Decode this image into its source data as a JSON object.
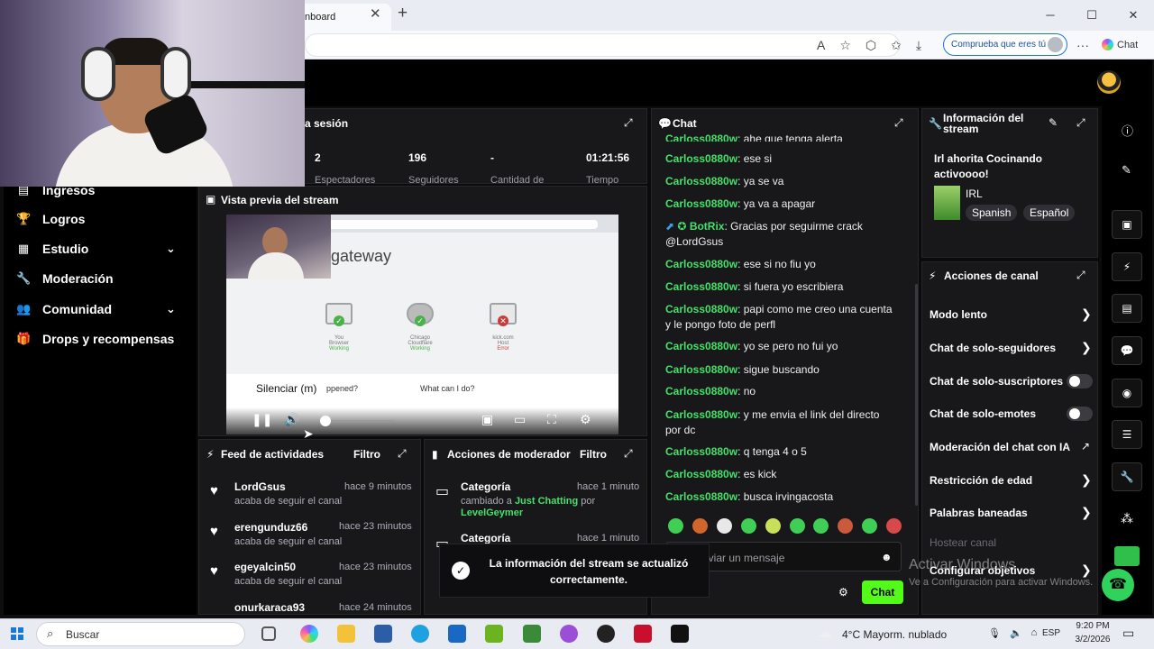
{
  "browser": {
    "tab_title": "nboard",
    "tab_close": "✕",
    "new_tab": "+",
    "copilot_button": "Comprueba que eres tú",
    "chat_label": "Chat",
    "more": "···",
    "window": {
      "minimize": "─",
      "maximize": "☐",
      "close": "✕"
    }
  },
  "sidebar": {
    "items": [
      {
        "label": "Ingresos",
        "icon": "ingresos-icon",
        "glyph": "▤"
      },
      {
        "label": "Logros",
        "icon": "trophy-icon",
        "glyph": "🏆"
      },
      {
        "label": "Estudio",
        "icon": "studio-icon",
        "glyph": "▦",
        "chevron": "⌄"
      },
      {
        "label": "Moderación",
        "icon": "wrench-icon",
        "glyph": "🔧"
      },
      {
        "label": "Comunidad",
        "icon": "community-icon",
        "glyph": "👥",
        "chevron": "⌄"
      },
      {
        "label": "Drops y recompensas",
        "icon": "gift-icon",
        "glyph": "🎁"
      }
    ]
  },
  "session": {
    "title": "a sesión",
    "stats": [
      {
        "value": "2",
        "label": "Espectadores"
      },
      {
        "value": "196",
        "label": "Seguidores"
      },
      {
        "value": "-",
        "label": "Cantidad de"
      },
      {
        "value": "01:21:56",
        "label": "Tiempo"
      }
    ]
  },
  "preview": {
    "title": "Vista previa del stream",
    "page_title": "gateway",
    "tooltip": "Silenciar (m)",
    "question1": "ppened?",
    "question2": "What can I do?",
    "nodes": [
      {
        "label": "You",
        "sub": "Browser",
        "status": "Working"
      },
      {
        "label": "Chicago",
        "sub": "Cloudflare",
        "status": "Working"
      },
      {
        "label": "kick.com",
        "sub": "Host",
        "status": "Error"
      }
    ]
  },
  "feed": {
    "title": "Feed de actividades",
    "filter": "Filtro",
    "items": [
      {
        "name": "LordGsus",
        "time": "hace 9 minutos",
        "desc": "acaba de seguir el canal"
      },
      {
        "name": "erengunduz66",
        "time": "hace 23 minutos",
        "desc": "acaba de seguir el canal"
      },
      {
        "name": "egeyalcin50",
        "time": "hace 23 minutos",
        "desc": "acaba de seguir el canal"
      },
      {
        "name": "onurkaraca93",
        "time": "hace 24 minutos",
        "desc": ""
      }
    ]
  },
  "modactions": {
    "title": "Acciones de moderador",
    "filter": "Filtro",
    "items": [
      {
        "title": "Categoría",
        "time": "hace 1 minuto",
        "line1": "cambiado a ",
        "highlight": "Just Chatting",
        "line1b": " por",
        "user": "LevelGeymer"
      },
      {
        "title": "Categoría",
        "time": "hace 1 minuto"
      }
    ]
  },
  "chat": {
    "title": "Chat",
    "messages": [
      {
        "user": "Carloss0880w",
        "text": "ahe que tenga alerta"
      },
      {
        "user": "Carloss0880w",
        "text": "ese si"
      },
      {
        "user": "Carloss0880w",
        "text": "ya se va"
      },
      {
        "user": "Carloss0880w",
        "text": "ya va a apagar"
      },
      {
        "user": "BotRix",
        "text": "Gracias por seguirme crack @LordGsus"
      },
      {
        "user": "Carloss0880w",
        "text": "ese si no fiu yo"
      },
      {
        "user": "Carloss0880w",
        "text": "si fuera yo escribiera"
      },
      {
        "user": "Carloss0880w",
        "text": "papi como me creo una cuenta y le pongo foto de perfl"
      },
      {
        "user": "Carloss0880w",
        "text": "yo se pero no fui yo"
      },
      {
        "user": "Carloss0880w",
        "text": "sigue buscando"
      },
      {
        "user": "Carloss0880w",
        "text": "no"
      },
      {
        "user": "Carloss0880w",
        "text": "y me envia el link del directo por dc"
      },
      {
        "user": "Carloss0880w",
        "text": "q tenga 4 o 5"
      },
      {
        "user": "Carloss0880w",
        "text": "es kick"
      },
      {
        "user": "Carloss0880w",
        "text": "busca irvingacosta"
      }
    ],
    "input_placeholder": "nviar un mensaje",
    "send": "Chat"
  },
  "streaminfo": {
    "title": "Información del stream",
    "stream_title": "Irl ahorita Cocinando activoooo!",
    "category": "IRL",
    "tags": [
      "Spanish",
      "Español"
    ]
  },
  "channel": {
    "title": "Acciones de canal",
    "items": [
      {
        "label": "Modo lento",
        "kind": "chevron"
      },
      {
        "label": "Chat de solo-seguidores",
        "kind": "chevron"
      },
      {
        "label": "Chat de solo-suscriptores",
        "kind": "toggle"
      },
      {
        "label": "Chat de solo-emotes",
        "kind": "toggle"
      },
      {
        "label": "Moderación del chat con IA",
        "kind": "external"
      },
      {
        "label": "Restricción de edad",
        "kind": "chevron"
      },
      {
        "label": "Palabras baneadas",
        "kind": "chevron"
      },
      {
        "label": "Hostear canal",
        "kind": "disabled"
      },
      {
        "label": "Configurar objetivos",
        "kind": "chevron"
      }
    ]
  },
  "toast": {
    "text": "La información del stream se actualizó correctamente."
  },
  "watermark": {
    "line1": "Activar Windows",
    "line2": "Ve a Configuración para activar Windows."
  },
  "taskbar": {
    "search": "Buscar",
    "weather": "4°C  Mayorm. nublado",
    "lang": "ESP",
    "time": "9:20 PM",
    "date": "3/2/2026"
  },
  "colors": {
    "accent": "#53fc18",
    "username": "#46e06a",
    "panel": "#18181b"
  }
}
